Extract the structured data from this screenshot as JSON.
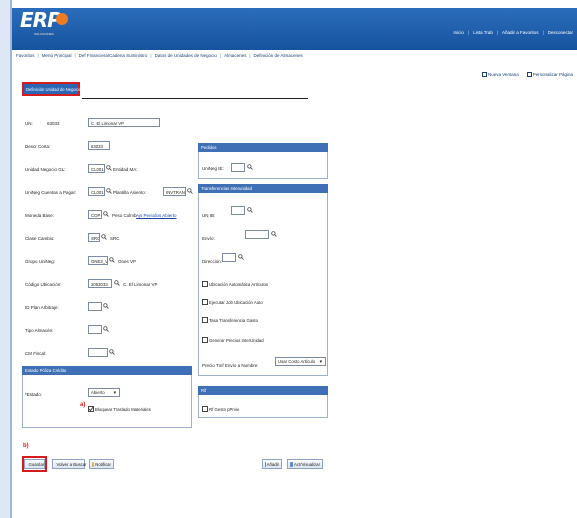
{
  "app": {
    "logo": "ERP",
    "logo_sub": "SOLUCIONES"
  },
  "header": {
    "links": [
      "Inicio",
      "Lista Trab",
      "Añadir a Favoritos",
      "Desconectar"
    ]
  },
  "breadcrumb": [
    "Favoritos",
    "Menú Principal",
    "Def Financiera/Cadena Suministro",
    "Datos de Unidades de Negocio",
    "Almacenes",
    "Definición de Almacenes"
  ],
  "right_links": [
    "Nueva Ventana",
    "Personalizar Página"
  ],
  "page": {
    "title": "Definición Unidad de Negocio"
  },
  "form": {
    "un_label": "UN:",
    "un_value": "63033",
    "un_desc": "C. El Limonar VP",
    "desc_corta_label": "Descr Corta:",
    "desc_corta_value": "63033",
    "unidad_negocio_gl_label": "Unidad Negocio GL:",
    "unidad_negocio_gl_value": "CL001",
    "entidad_ma_label": "Entidad MA:",
    "unneg_cuentas_pagar_label": "UniNeg Cuentas a Pagar:",
    "unneg_cuentas_pagar_value": "CL001",
    "plantilla_asiento_label": "Plantilla Asiento:",
    "plantilla_asiento_value": "INVTRANS",
    "moneda_base_label": "Moneda Base:",
    "moneda_base_value": "COP",
    "peso_label": "Peso Colmb",
    "ajs_periodo_link": "Ajs Periodos Abierto",
    "clase_cambio_label": "Clase Cambio:",
    "clase_cambio_value": "SRC",
    "clase_cambio_desc": "SRC",
    "grupo_unneg_label": "Grupo UniNeg:",
    "grupo_unneg_value": "ONE3_VP",
    "grupo_unneg_desc": "Ones VP",
    "codigo_ubicacion_label": "Código Ubicación:",
    "codigo_ubicacion_value": "2063033",
    "codigo_ubicacion_desc": "C. El Limonar VP",
    "id_plan_arbitraje_label": "ID Plan Arbitraje:",
    "tipo_almacen_label": "Tipo Almacén:",
    "cm_fiscal_label": "CM Fiscal:",
    "pedidos_header": "Pedidos",
    "unneg_ic_label": "UniNeg IE:",
    "transfer_header": "Transferencias Interunidad",
    "un_ib_label": "UN IB:",
    "envio_label": "Envío:",
    "direccion_label": "Dirección:",
    "chk_ubicacion": "Ubicación Automática Artículos",
    "chk_ejecutar": "Ejecutar Job Ubicación Auto",
    "chk_tasa": "Tasa Transferencia Gasto",
    "chk_generar": "Generar Precios InterUnidad",
    "precio_label": "Precio Tmf Envío a Nombre:",
    "precio_value": "Usar Costo Artículo",
    "estado_header": "Estado Póliza Crédito",
    "estado_label": "*Estado:",
    "estado_value": "Abierto",
    "chk_bloquear": "Bloquear Traslado Materiales",
    "a_marker": "a)",
    "rif_header": "Rif",
    "chk_rif": "Rf Gestn pPrvie"
  },
  "markers": {
    "b": "b)"
  },
  "buttons": {
    "guardar": "Guardar",
    "volver_buscar": "Volver a Buscar",
    "notificar": "Notificar",
    "anadir": "Añadir",
    "act_visualizar": "Act/Visualizar"
  },
  "colors": {
    "header_blue": "#1b5aa7",
    "accent_red": "#d41c1c",
    "group_header": "#3f6fb4"
  }
}
